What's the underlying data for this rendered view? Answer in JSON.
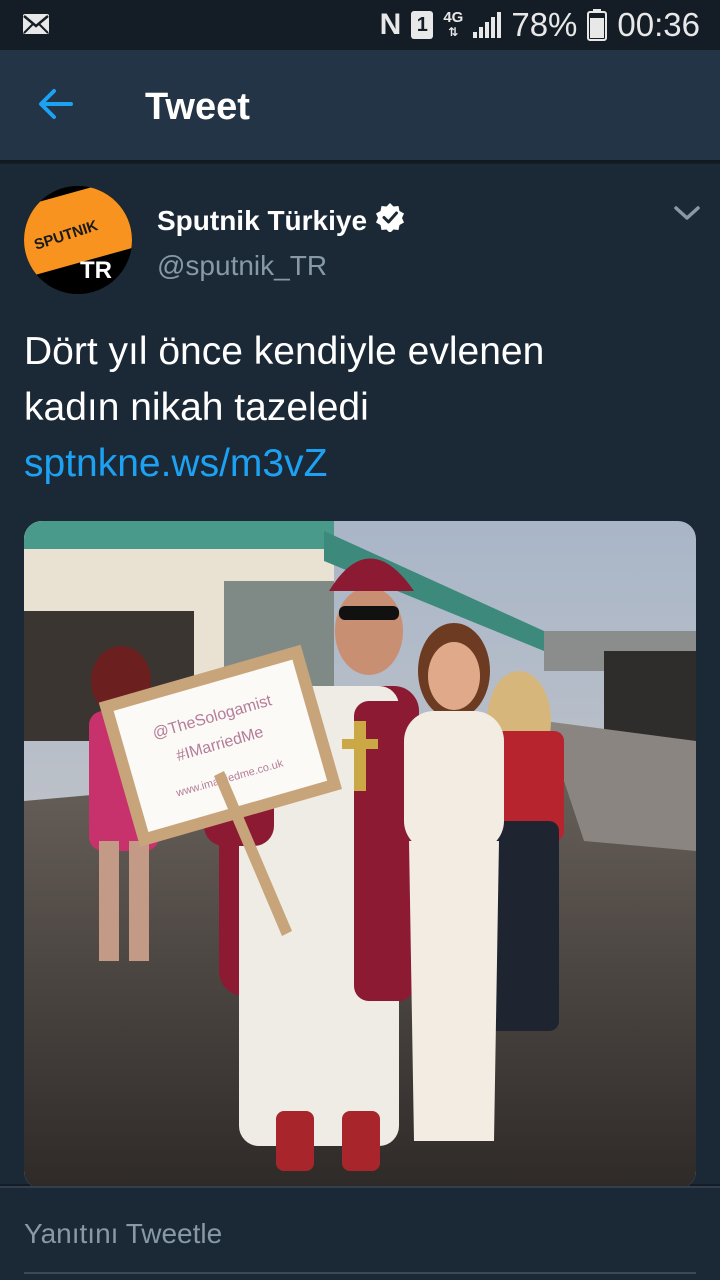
{
  "status_bar": {
    "notification_icon": "mail-icon",
    "nfc_label": "N",
    "sim_label": "1",
    "network_label": "4G",
    "battery_percent": "78%",
    "time": "00:36"
  },
  "header": {
    "back_icon": "arrow-left-icon",
    "title": "Tweet"
  },
  "tweet": {
    "author": {
      "name": "Sputnik Türkiye",
      "handle": "@sputnik_TR",
      "verified": true,
      "avatar_top_text": "SPUTNIK",
      "avatar_bottom_text": "TR"
    },
    "text_line1": "Dört yıl önce kendiyle evlenen",
    "text_line2": "kadın nikah tazeledi",
    "link": "sptnkne.ws/m3vZ",
    "photo": {
      "sign_line1": "@TheSologamist",
      "sign_line2": "#IMarriedMe",
      "sign_line3": "www.imarriedme.co.uk"
    }
  },
  "reply": {
    "placeholder": "Yanıtını Tweetle"
  },
  "colors": {
    "background": "#141d26",
    "appbar": "#243447",
    "card": "#1b2836",
    "accent": "#1da1f2",
    "muted": "#8899a6",
    "sputnik_orange": "#f7931e"
  }
}
